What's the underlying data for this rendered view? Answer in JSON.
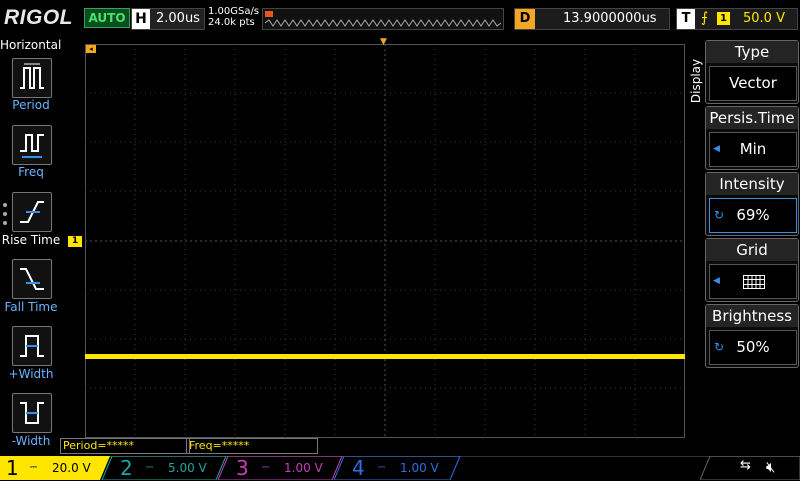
{
  "brand": "RIGOL",
  "trigger_status": "AUTO",
  "horizontal": {
    "key": "H",
    "timebase": "2.00us"
  },
  "acquisition": {
    "sample_rate": "1.00GSa/s",
    "memory_depth": "24.0k pts"
  },
  "delay": {
    "key": "D",
    "value": "13.9000000us"
  },
  "trigger": {
    "key": "T",
    "source": "1",
    "level": "50.0 V"
  },
  "left_menu": {
    "title": "Horizontal",
    "items": [
      {
        "label": "Period"
      },
      {
        "label": "Freq"
      },
      {
        "label": "Rise Time"
      },
      {
        "label": "Fall Time"
      },
      {
        "label": "+Width"
      },
      {
        "label": "-Width"
      }
    ]
  },
  "ch1_marker": "1",
  "measurements": [
    {
      "text": "Period=*****"
    },
    {
      "text": "Freq=*****"
    }
  ],
  "right_menu": {
    "tab": "Display",
    "items": [
      {
        "title": "Type",
        "value": "Vector"
      },
      {
        "title": "Persis.Time",
        "value": "Min"
      },
      {
        "title": "Intensity",
        "value": "69%"
      },
      {
        "title": "Grid",
        "value": ""
      },
      {
        "title": "Brightness",
        "value": "50%"
      }
    ]
  },
  "channels": [
    {
      "num": "1",
      "scale": "20.0 V",
      "color": "#ffe600",
      "active": true
    },
    {
      "num": "2",
      "scale": "5.00 V",
      "color": "#1fa5a0",
      "active": false
    },
    {
      "num": "3",
      "scale": "1.00 V",
      "color": "#c83fb8",
      "active": false
    },
    {
      "num": "4",
      "scale": "1.00 V",
      "color": "#2f6fe0",
      "active": false
    }
  ],
  "icons": {
    "usb": "usb-icon",
    "mute": "speaker-mute-icon",
    "trigger_edge": "rising-edge-icon"
  },
  "colors": {
    "ch1": "#ffe600",
    "accent": "#3a8ee6",
    "delay": "#f5a623",
    "auto": "#4ae16d"
  }
}
